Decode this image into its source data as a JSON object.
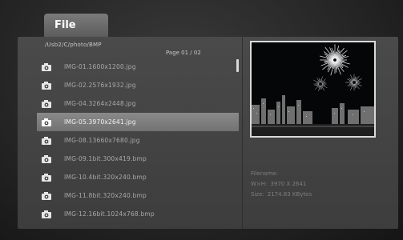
{
  "tab": {
    "label": "File"
  },
  "path": "/Usb2/C/photo/BMP",
  "page": "Page  01 / 02",
  "files": [
    {
      "name": "IMG-01.1600x1200.jpg",
      "selected": false
    },
    {
      "name": "IMG-02.2576x1932.jpg",
      "selected": false
    },
    {
      "name": "IMG-04.3264x2448.jpg",
      "selected": false
    },
    {
      "name": "IMG-05.3970x2641.jpg",
      "selected": true
    },
    {
      "name": "IMG-08.13660x7680.jpg",
      "selected": false
    },
    {
      "name": "IMG-09.1bit.300x419.bmp",
      "selected": false
    },
    {
      "name": "IMG-10.4bit.320x240.bmp",
      "selected": false
    },
    {
      "name": "IMG-11.8bit.320x240.bmp",
      "selected": false
    },
    {
      "name": "IMG-12.16bit.1024x768.bmp",
      "selected": false
    }
  ],
  "info": {
    "filename_label": "Filename:",
    "wh_label": "W×H:",
    "wh_value": "3970 X 2641",
    "size_label": "Size:",
    "size_value": "2174.83 KBytes"
  },
  "icons": {
    "file": "camera-icon"
  },
  "colors": {
    "selection": "#7e7e7e",
    "panel": "#444444",
    "tab": "#6b6b6b"
  }
}
